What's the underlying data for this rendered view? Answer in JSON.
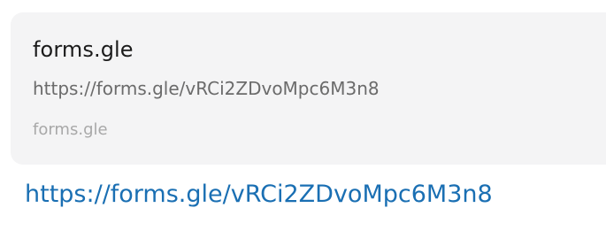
{
  "link_preview": {
    "title": "forms.gle",
    "url": "https://forms.gle/vRCi2ZDvoMpc6M3n8",
    "domain": "forms.gle"
  },
  "message": {
    "link_text": "https://forms.gle/vRCi2ZDvoMpc6M3n8"
  },
  "colors": {
    "card_background": "#f4f4f5",
    "title": "#1b1b1b",
    "url": "#6b6b6b",
    "domain": "#a8a8a8",
    "link": "#1a6fb3"
  }
}
